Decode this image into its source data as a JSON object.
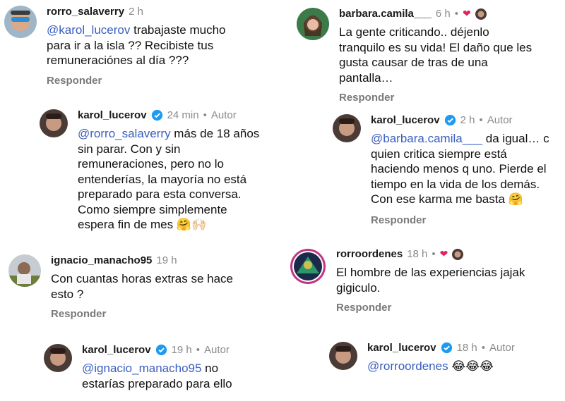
{
  "reply_label": "Responder",
  "author_label": "Autor",
  "left": [
    {
      "username": "rorro_salaverry",
      "time": "2 h",
      "mention": "@karol_lucerov",
      "text": " trabajaste mucho para ir a la isla ?? Recibiste tus remuneraciónes al día ???"
    },
    {
      "username": "karol_lucerov",
      "time": "24 min",
      "mention": "@rorro_salaverry",
      "text": " más de 18 años sin parar. Con y sin remuneraciones, pero no lo entenderías, la mayoría no está preparado para esta conversa. Como siempre simplemente espera fin de mes ",
      "emoji": "🤗🙌🏻"
    },
    {
      "username": "ignacio_manacho95",
      "time": "19 h",
      "text": "Con cuantas horas extras se hace esto ?"
    },
    {
      "username": "karol_lucerov",
      "time": "19 h",
      "mention": "@ignacio_manacho95",
      "text": " no estarías preparado para ello"
    }
  ],
  "right": [
    {
      "username": "barbara.camila___",
      "time": "6 h",
      "text": "La gente criticando.. déjenlo tranquilo es su vida! El daño que les gusta causar de tras de una pantalla…"
    },
    {
      "username": "karol_lucerov",
      "time": "2 h",
      "mention": "@barbara.camila___",
      "text": " da igual… c quien critica siempre está haciendo menos q uno. Pierde el tiempo en la vida de los demás. Con ese karma me basta ",
      "emoji": "🤗"
    },
    {
      "username": "rorroordenes",
      "time": "18 h",
      "text": "El hombre de las experiencias jajak gigiculo."
    },
    {
      "username": "karol_lucerov",
      "time": "18 h",
      "mention": "@rorroordenes",
      "text": " ",
      "emoji": "😂😂😂"
    }
  ],
  "icons": {
    "verified": "verified-badge-icon",
    "heart": "heart-icon"
  },
  "colors": {
    "mention": "#3a5ec0",
    "verified": "#1d9bf0",
    "heart": "#e0245e"
  }
}
